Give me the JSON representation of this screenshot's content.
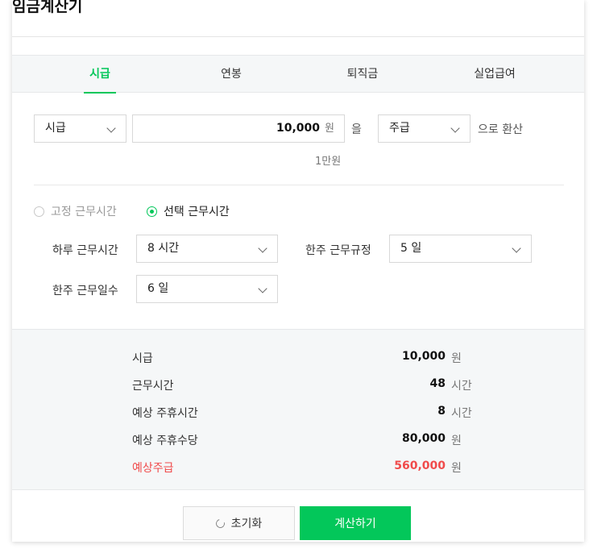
{
  "app": {
    "title": "임금계산기"
  },
  "tabs": [
    {
      "label": "시급",
      "active": true
    },
    {
      "label": "연봉",
      "active": false
    },
    {
      "label": "퇴직금",
      "active": false
    },
    {
      "label": "실업급여",
      "active": false
    }
  ],
  "converter": {
    "from_select": "시급",
    "amount_value": "10,000",
    "amount_unit": "원",
    "particle": "을",
    "to_select": "주급",
    "suffix": "으로 환산",
    "hint": "1만원"
  },
  "work_mode": {
    "fixed_label": "고정 근무시간",
    "fixed_selected": false,
    "select_label": "선택 근무시간",
    "select_selected": true
  },
  "fields": {
    "daily_hours_label": "하루 근무시간",
    "daily_hours_value": "8 시간",
    "weekly_rule_label": "한주 근무규정",
    "weekly_rule_value": "5 일",
    "weekly_days_label": "한주 근무일수",
    "weekly_days_value": "6 일"
  },
  "results": [
    {
      "label": "시급",
      "value": "10,000",
      "unit": "원",
      "highlight": false
    },
    {
      "label": "근무시간",
      "value": "48",
      "unit": "시간",
      "highlight": false
    },
    {
      "label": "예상 주휴시간",
      "value": "8",
      "unit": "시간",
      "highlight": false
    },
    {
      "label": "예상 주휴수당",
      "value": "80,000",
      "unit": "원",
      "highlight": false
    },
    {
      "label": "예상주급",
      "value": "560,000",
      "unit": "원",
      "highlight": true
    }
  ],
  "buttons": {
    "reset_label": "초기화",
    "calculate_label": "계산하기"
  },
  "colors": {
    "accent": "#03c75a",
    "highlight": "#f04b4b"
  }
}
